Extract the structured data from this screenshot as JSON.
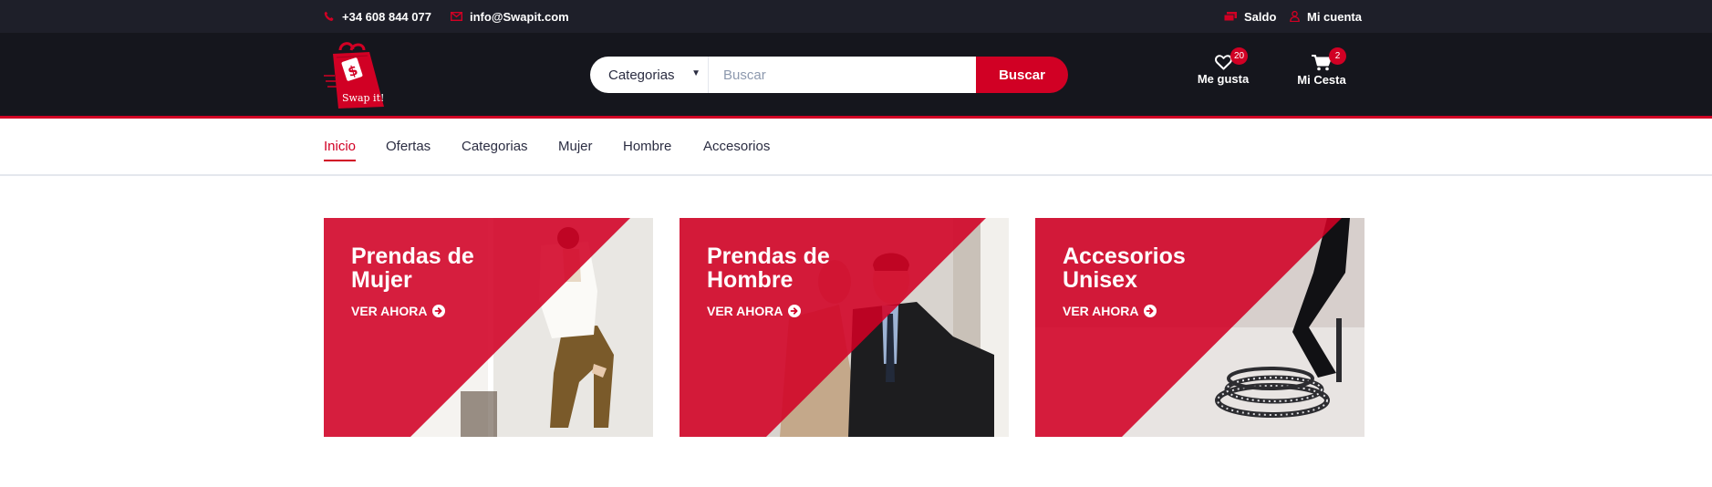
{
  "topbar": {
    "phone": "+34 608 844 077",
    "email": "info@Swapit.com",
    "balance_label": "Saldo",
    "account_label": "Mi cuenta"
  },
  "header": {
    "logo_text": "Swap it!",
    "search": {
      "category_selected": "Categorias",
      "placeholder": "Buscar",
      "button_label": "Buscar"
    },
    "wishlist": {
      "label": "Me gusta",
      "count": "20"
    },
    "cart": {
      "label": "Mi Cesta",
      "count": "2"
    }
  },
  "nav": {
    "items": [
      {
        "label": "Inicio",
        "active": true
      },
      {
        "label": "Ofertas"
      },
      {
        "label": "Categorias"
      },
      {
        "label": "Mujer"
      },
      {
        "label": "Hombre"
      },
      {
        "label": "Accesorios"
      }
    ]
  },
  "collections": [
    {
      "title": "Prendas de\nMujer",
      "cta": "VER AHORA"
    },
    {
      "title": "Prendas de\nHombre",
      "cta": "VER AHORA"
    },
    {
      "title": "Accesorios\nUnisex",
      "cta": "VER AHORA"
    }
  ],
  "colors": {
    "accent": "#d10024",
    "topbar_bg": "#1e1f29",
    "header_bg": "#15161d",
    "text_dark": "#2b2d42"
  },
  "icons": {
    "phone": "phone-icon",
    "email": "envelope-icon",
    "balance": "money-icon",
    "account": "user-icon",
    "wishlist": "heart-icon",
    "cart": "shopping-cart-icon",
    "cta": "arrow-circle-right-icon"
  }
}
